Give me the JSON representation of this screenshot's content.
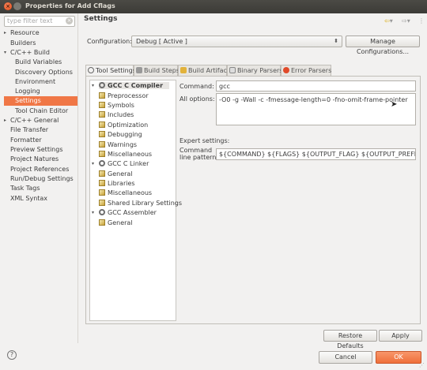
{
  "window": {
    "title": "Properties for Add Cflags"
  },
  "filter": {
    "placeholder": "type filter text"
  },
  "nav": {
    "items": [
      {
        "label": "Resource",
        "expander": "▸"
      },
      {
        "label": "Builders",
        "expander": ""
      },
      {
        "label": "C/C++ Build",
        "expander": "▾"
      },
      {
        "label": "Build Variables",
        "expander": ""
      },
      {
        "label": "Discovery Options",
        "expander": ""
      },
      {
        "label": "Environment",
        "expander": ""
      },
      {
        "label": "Logging",
        "expander": ""
      },
      {
        "label": "Settings",
        "expander": ""
      },
      {
        "label": "Tool Chain Editor",
        "expander": ""
      },
      {
        "label": "C/C++ General",
        "expander": "▸"
      },
      {
        "label": "File Transfer",
        "expander": ""
      },
      {
        "label": "Formatter",
        "expander": ""
      },
      {
        "label": "Preview Settings",
        "expander": ""
      },
      {
        "label": "Project Natures",
        "expander": ""
      },
      {
        "label": "Project References",
        "expander": ""
      },
      {
        "label": "Run/Debug Settings",
        "expander": ""
      },
      {
        "label": "Task Tags",
        "expander": ""
      },
      {
        "label": "XML Syntax",
        "expander": ""
      }
    ],
    "selected": "Settings"
  },
  "page": {
    "heading": "Settings",
    "configuration_label": "Configuration:",
    "configuration_value": "Debug  [ Active ]",
    "manage_button": "Manage Configurations..."
  },
  "tabs": [
    {
      "label": "Tool Settings",
      "active": true
    },
    {
      "label": "Build Steps",
      "active": false
    },
    {
      "label": "Build Artifact",
      "active": false
    },
    {
      "label": "Binary Parsers",
      "active": false
    },
    {
      "label": "Error Parsers",
      "active": false
    }
  ],
  "tree": {
    "compiler": "GCC C Compiler",
    "compiler_children": [
      "Preprocessor",
      "Symbols",
      "Includes",
      "Optimization",
      "Debugging",
      "Warnings",
      "Miscellaneous"
    ],
    "linker": "GCC C Linker",
    "linker_children": [
      "General",
      "Libraries",
      "Miscellaneous",
      "Shared Library Settings"
    ],
    "assembler": "GCC Assembler",
    "assembler_children": [
      "General"
    ]
  },
  "tool": {
    "command_label": "Command:",
    "command_value": "gcc",
    "all_options_label": "All options:",
    "all_options_value": "-O0 -g -Wall -c -fmessage-length=0 -fno-omit-frame-pointer",
    "expert_label": "Expert settings:",
    "pattern_label_1": "Command",
    "pattern_label_2": "line pattern:",
    "pattern_value": "${COMMAND} ${FLAGS} ${OUTPUT_FLAG} ${OUTPUT_PREFIX}${OUTPUT}"
  },
  "buttons": {
    "restore_defaults": "Restore Defaults",
    "apply": "Apply",
    "cancel": "Cancel",
    "ok": "OK"
  },
  "colors": {
    "accent": "#f07746",
    "titlebar": "#3c3b37"
  }
}
